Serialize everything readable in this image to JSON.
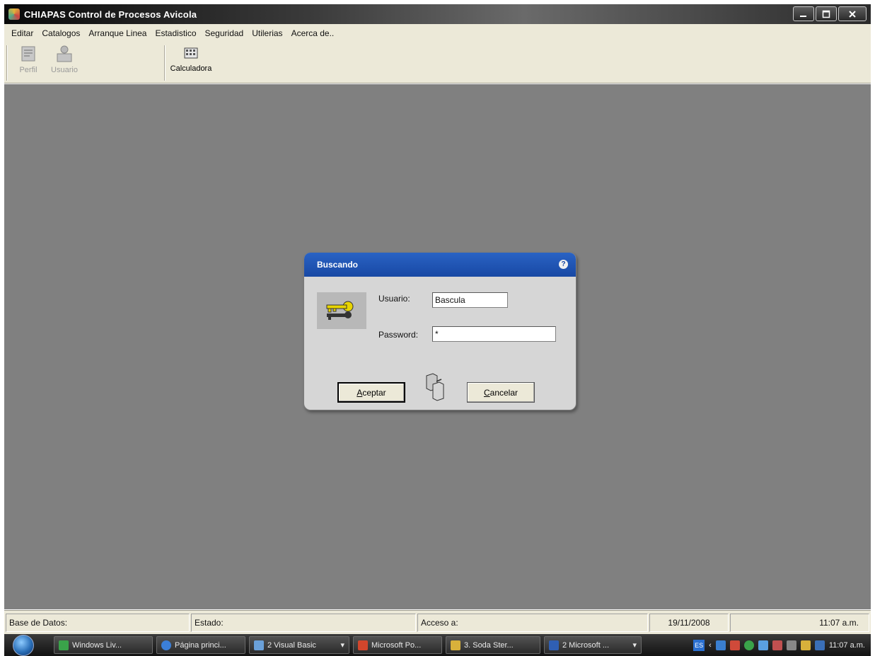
{
  "window": {
    "title": "CHIAPAS Control de Procesos Avicola",
    "buttons": [
      "minimize",
      "maximize",
      "close"
    ]
  },
  "menu": {
    "items": [
      "Editar",
      "Catalogos",
      "Arranque Linea",
      "Estadistico",
      "Seguridad",
      "Utilerias",
      "Acerca de.."
    ]
  },
  "toolbar": {
    "perfil_label": "Perfil",
    "usuario_label": "Usuario",
    "calculadora_label": "Calculadora"
  },
  "dialog": {
    "title": "Buscando",
    "help_glyph": "?",
    "usuario_label": "Usuario:",
    "usuario_value": "Bascula",
    "password_label": "Password:",
    "password_value": "*",
    "accept_prefix": "A",
    "accept_rest": "ceptar",
    "cancel_prefix": "C",
    "cancel_rest": "ancelar"
  },
  "statusbar": {
    "database_label": "Base de Datos:",
    "status_label": "Estado:",
    "access_label": "Acceso a:",
    "date": "19/11/2008",
    "time": "11:07 a.m."
  },
  "taskbar": {
    "items": [
      {
        "label": "Windows Liv...",
        "icon_color": "#3aa34a"
      },
      {
        "label": "Página princi...",
        "icon_color": "#3b7fd8"
      },
      {
        "label": "2 Visual Basic",
        "icon_color": "#6aa0d8"
      },
      {
        "label": "Microsoft Po...",
        "icon_color": "#d2462c"
      },
      {
        "label": "3. Soda Ster...",
        "icon_color": "#d8b13b"
      },
      {
        "label": "2 Microsoft ...",
        "icon_color": "#2f5fb3"
      }
    ],
    "language": "ES",
    "clock": "11:07 a.m."
  }
}
